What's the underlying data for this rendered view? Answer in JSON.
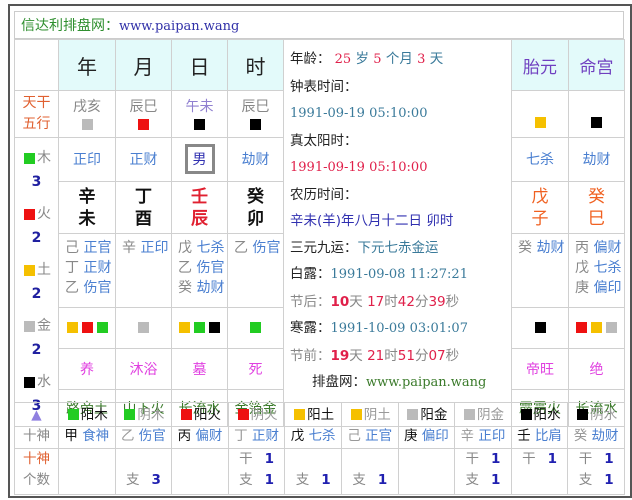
{
  "title": {
    "site": "信达利排盘网：",
    "url": "www.paipan.wang"
  },
  "colors": {
    "木": "#22cc22",
    "火": "#ee1111",
    "土": "#f5c000",
    "金": "#bbbbbb",
    "水": "#000000",
    "header_bg": "#e3fafa"
  },
  "pillars": [
    {
      "header": "年",
      "wuxing": "戌亥",
      "wuxing_color": "#bbbbbb",
      "shishen": "正印",
      "stem": "辛",
      "branch": "未",
      "hidden": [
        [
          "己",
          "正官"
        ],
        [
          "丁",
          "正财"
        ],
        [
          "乙",
          "伤官"
        ]
      ],
      "elements": [
        "#f5c000",
        "#ee1111",
        "#22cc22"
      ],
      "changsheng": "养",
      "nayin": "路旁土"
    },
    {
      "header": "月",
      "wuxing": "辰巳",
      "wuxing_color": "#ee1111",
      "shishen": "正财",
      "stem": "丁",
      "branch": "酉",
      "hidden": [
        [
          "辛",
          "正印"
        ]
      ],
      "elements": [
        "#bbbbbb"
      ],
      "changsheng": "沐浴",
      "nayin": "山下火"
    },
    {
      "header": "日",
      "wuxing": "午未",
      "wuxing_color": "#000000",
      "shishen": "男",
      "stem": "壬",
      "branch": "辰",
      "hidden": [
        [
          "戊",
          "七杀"
        ],
        [
          "乙",
          "伤官"
        ],
        [
          "癸",
          "劫财"
        ]
      ],
      "elements": [
        "#f5c000",
        "#22cc22",
        "#000000"
      ],
      "changsheng": "墓",
      "nayin": "长流水"
    },
    {
      "header": "时",
      "wuxing": "辰巳",
      "wuxing_color": "#000000",
      "shishen": "劫财",
      "stem": "癸",
      "branch": "卯",
      "hidden": [
        [
          "乙",
          "伤官"
        ]
      ],
      "elements": [
        "#22cc22"
      ],
      "changsheng": "死",
      "nayin": "金箔金"
    }
  ],
  "extra": [
    {
      "header": "胎元",
      "wuxing_color": "#f5c000",
      "shishen": "七杀",
      "stem": "戊",
      "branch": "子",
      "hidden": [
        [
          "癸",
          "劫财"
        ]
      ],
      "elements": [
        "#000000"
      ],
      "changsheng": "帝旺",
      "nayin": "霹雳火"
    },
    {
      "header": "命宫",
      "wuxing_color": "#000000",
      "shishen": "劫财",
      "stem": "癸",
      "branch": "巳",
      "hidden": [
        [
          "丙",
          "偏财"
        ],
        [
          "戊",
          "七杀"
        ],
        [
          "庚",
          "偏印"
        ]
      ],
      "elements": [
        "#ee1111",
        "#f5c000",
        "#bbbbbb"
      ],
      "changsheng": "绝",
      "nayin": "长流水"
    }
  ],
  "left": {
    "label1": "天干",
    "label2": "五行"
  },
  "wuxing_counts": [
    {
      "name": "木",
      "count": "3",
      "color": "#22cc22"
    },
    {
      "name": "火",
      "count": "2",
      "color": "#ee1111"
    },
    {
      "name": "土",
      "count": "2",
      "color": "#f5c000"
    },
    {
      "name": "金",
      "count": "2",
      "color": "#bbbbbb"
    },
    {
      "name": "水",
      "count": "3",
      "color": "#000000"
    }
  ],
  "info": {
    "age_label": "年龄：",
    "age_years": "25",
    "age_y_unit": "岁",
    "age_months": "5",
    "age_m_unit": "个月",
    "age_days": "3",
    "age_d_unit": "天",
    "clock_label": "钟表时间：",
    "clock": "1991-09-19 05:10:00",
    "solar_label": "真太阳时：",
    "solar": "1991-09-19 05:10:00",
    "lunar_label": "农历时间：",
    "lunar": "辛未(羊)年八月十二日 卯时",
    "sanyuan_label": "三元九运：",
    "sanyuan": "下元七赤金运",
    "jie1_label": "白露：",
    "jie1": "1991-09-08 11:27:21",
    "after_label": "节后：",
    "after": [
      "10",
      "天 ",
      "17",
      "时",
      "42",
      "分",
      "39",
      "秒"
    ],
    "jie2_label": "寒露：",
    "jie2": "1991-10-09 03:01:07",
    "before_label": "节前：",
    "before": [
      "19",
      "天 ",
      "21",
      "时",
      "51",
      "分",
      "07",
      "秒"
    ],
    "site_label": "排盘网：",
    "site": "www.paipan.wang"
  },
  "bottom": {
    "shishen_label": "十神",
    "count_label1": "十神",
    "count_label2": "个数",
    "cols": [
      {
        "color": "#22cc22",
        "name": "阳木",
        "yang": true,
        "stem": "甲",
        "god": "食神",
        "gan": "",
        "zhi": ""
      },
      {
        "color": "#22cc22",
        "name": "阴木",
        "yang": false,
        "stem": "乙",
        "god": "伤官",
        "gan": "",
        "zhi": "3"
      },
      {
        "color": "#ee1111",
        "name": "阳火",
        "yang": true,
        "stem": "丙",
        "god": "偏财",
        "gan": "",
        "zhi": ""
      },
      {
        "color": "#ee1111",
        "name": "阴火",
        "yang": false,
        "stem": "丁",
        "god": "正财",
        "gan": "1",
        "zhi": "1"
      },
      {
        "color": "#f5c000",
        "name": "阳土",
        "yang": true,
        "stem": "戊",
        "god": "七杀",
        "gan": "",
        "zhi": "1"
      },
      {
        "color": "#f5c000",
        "name": "阴土",
        "yang": false,
        "stem": "己",
        "god": "正官",
        "gan": "",
        "zhi": "1"
      },
      {
        "color": "#bbbbbb",
        "name": "阳金",
        "yang": true,
        "stem": "庚",
        "god": "偏印",
        "gan": "",
        "zhi": ""
      },
      {
        "color": "#bbbbbb",
        "name": "阴金",
        "yang": false,
        "stem": "辛",
        "god": "正印",
        "gan": "1",
        "zhi": "1"
      },
      {
        "color": "#000000",
        "name": "阳水",
        "yang": true,
        "stem": "壬",
        "god": "比肩",
        "gan": "1",
        "zhi": ""
      },
      {
        "color": "#000000",
        "name": "阴水",
        "yang": false,
        "stem": "癸",
        "god": "劫财",
        "gan": "1",
        "zhi": "1"
      }
    ],
    "gan_label": "干",
    "zhi_label": "支"
  }
}
